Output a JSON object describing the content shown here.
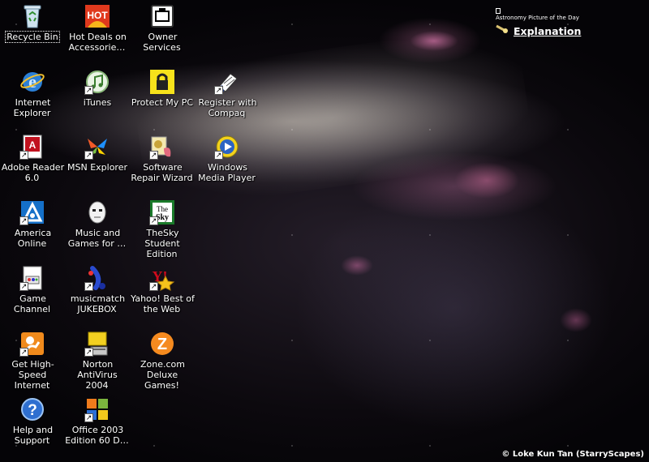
{
  "desktop": {
    "icons": [
      {
        "id": "recycle-bin",
        "label": "Recycle Bin",
        "icon": "recycle-bin-icon",
        "shortcut": false,
        "selected": true
      },
      {
        "id": "internet-explorer",
        "label": "Internet Explorer",
        "icon": "internet-explorer-icon",
        "shortcut": false
      },
      {
        "id": "adobe-reader",
        "label": "Adobe Reader 6.0",
        "icon": "adobe-reader-icon",
        "shortcut": true
      },
      {
        "id": "america-online",
        "label": "America Online",
        "icon": "aol-icon",
        "shortcut": true
      },
      {
        "id": "game-channel",
        "label": "Game Channel",
        "icon": "game-channel-icon",
        "shortcut": true
      },
      {
        "id": "get-high-speed-internet",
        "label": "Get High-Speed Internet",
        "icon": "high-speed-internet-icon",
        "shortcut": true
      },
      {
        "id": "help-and-support",
        "label": "Help and Support",
        "icon": "help-icon",
        "shortcut": false
      },
      {
        "id": "hot-deals",
        "label": "Hot Deals on Accessorie…",
        "icon": "hot-deals-icon",
        "shortcut": false
      },
      {
        "id": "itunes",
        "label": "iTunes",
        "icon": "itunes-icon",
        "shortcut": true
      },
      {
        "id": "msn-explorer",
        "label": "MSN Explorer",
        "icon": "msn-butterfly-icon",
        "shortcut": true
      },
      {
        "id": "music-and-games",
        "label": "Music and Games for …",
        "icon": "music-games-icon",
        "shortcut": false
      },
      {
        "id": "musicmatch-jukebox",
        "label": "musicmatch JUKEBOX",
        "icon": "musicmatch-icon",
        "shortcut": true
      },
      {
        "id": "norton-antivirus",
        "label": "Norton AntiVirus 2004",
        "icon": "norton-icon",
        "shortcut": true
      },
      {
        "id": "office-2003",
        "label": "Office 2003 Edition 60 D…",
        "icon": "office-icon",
        "shortcut": true
      },
      {
        "id": "owner-services",
        "label": "Owner Services",
        "icon": "owner-services-icon",
        "shortcut": false
      },
      {
        "id": "protect-my-pc",
        "label": "Protect My PC",
        "icon": "lock-icon",
        "shortcut": false
      },
      {
        "id": "software-repair-wizard",
        "label": "Software Repair Wizard",
        "icon": "repair-wizard-icon",
        "shortcut": true
      },
      {
        "id": "thesky-student",
        "label": "TheSky Student Edition",
        "icon": "thesky-icon",
        "shortcut": true
      },
      {
        "id": "yahoo-best",
        "label": "Yahoo! Best of the Web",
        "icon": "yahoo-icon",
        "shortcut": true
      },
      {
        "id": "zone-com",
        "label": "Zone.com Deluxe Games!",
        "icon": "zone-icon",
        "shortcut": false
      },
      {
        "id": "register-compaq",
        "label": "Register with Compaq",
        "icon": "register-compaq-icon",
        "shortcut": true
      },
      {
        "id": "windows-media-player",
        "label": "Windows Media Player",
        "icon": "media-player-icon",
        "shortcut": true
      }
    ]
  },
  "apod": {
    "caption": "Astronomy Picture of the Day",
    "link_label": "Explanation"
  },
  "credit": "© Loke Kun Tan  (StarryScapes)"
}
